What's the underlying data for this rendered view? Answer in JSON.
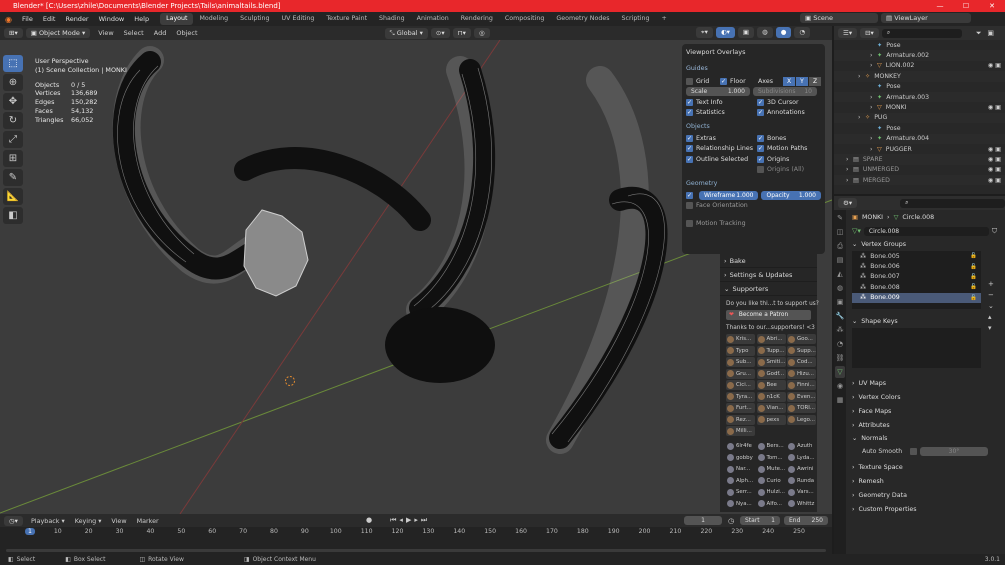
{
  "titlebar": {
    "title": "Blender* [C:\\Users\\zhile\\Documents\\Blender Projects\\Tails\\animaltails.blend]",
    "accent": "#e8272b"
  },
  "menu": {
    "items": [
      "File",
      "Edit",
      "Render",
      "Window",
      "Help"
    ],
    "workspaces": [
      "Layout",
      "Modeling",
      "Sculpting",
      "UV Editing",
      "Texture Paint",
      "Shading",
      "Animation",
      "Rendering",
      "Compositing",
      "Geometry Nodes",
      "Scripting"
    ],
    "active_workspace": "Layout",
    "scene": "Scene",
    "view_layer": "ViewLayer"
  },
  "viewport_header": {
    "mode": "Object Mode",
    "menus": [
      "View",
      "Select",
      "Add",
      "Object"
    ],
    "orientation": "Global"
  },
  "viewport_info": {
    "view_name": "User Perspective",
    "collection_line": "(1) Scene Collection | MONKI",
    "stats": [
      {
        "label": "Objects",
        "value": "0 / 5"
      },
      {
        "label": "Vertices",
        "value": "136,689"
      },
      {
        "label": "Edges",
        "value": "150,282"
      },
      {
        "label": "Faces",
        "value": "54,132"
      },
      {
        "label": "Triangles",
        "value": "66,052"
      }
    ]
  },
  "overlays": {
    "title": "Viewport Overlays",
    "guides_label": "Guides",
    "grid": "Grid",
    "floor": "Floor",
    "axes": "Axes",
    "axis_x": "X",
    "axis_y": "Y",
    "axis_z": "Z",
    "scale_label": "Scale",
    "scale_value": "1.000",
    "subdivisions_label": "Subdivisions",
    "subdivisions_value": "10",
    "text_info": "Text Info",
    "cursor_3d": "3D Cursor",
    "statistics": "Statistics",
    "annotations": "Annotations",
    "objects_label": "Objects",
    "extras": "Extras",
    "bones": "Bones",
    "relationship_lines": "Relationship Lines",
    "motion_paths": "Motion Paths",
    "outline_selected": "Outline Selected",
    "origins": "Origins",
    "origins_all": "Origins (All)",
    "geometry_label": "Geometry",
    "wireframe_label": "Wireframe",
    "wireframe_value": "1.000",
    "opacity_label": "Opacity",
    "opacity_value": "1.000",
    "face_orientation": "Face Orientation",
    "motion_tracking": "Motion Tracking"
  },
  "tail_panel": {
    "bake": "Bake",
    "settings": "Settings & Updates",
    "supporters": "Supporters",
    "question": "Do you like thi...t to support us?",
    "patron_button": "Become a Patron",
    "thanks": "Thanks to our...supporters! <3",
    "names_grid": [
      "Kris...",
      "Abri...",
      "Goo...",
      "Typo",
      "Tupp...",
      "Supp...",
      "Sub...",
      "Smiti...",
      "Cod...",
      "Gru...",
      "Godf...",
      "Hizu...",
      "Cici...",
      "Bee",
      "Finni...",
      "Tyra...",
      "n1cK",
      "Even...",
      "Furt...",
      "Vian...",
      "TORI...",
      "Rez...",
      "pexs",
      "Lego...",
      "Milli..."
    ],
    "names_list": [
      "6lr4fe",
      "Bers...",
      "Azuth",
      "gobby",
      "Tom...",
      "Lyda...",
      "Nar...",
      "Mute...",
      "Awrini",
      "Alph...",
      "Curio",
      "Runda",
      "Serr...",
      "Hulzi...",
      "Vars...",
      "Nya...",
      "Alfo...",
      "Whittz"
    ]
  },
  "timeline": {
    "menus": [
      "Playback",
      "Keying",
      "View",
      "Marker"
    ],
    "current_frame": "1",
    "start_label": "Start",
    "start_value": "1",
    "end_label": "End",
    "end_value": "250",
    "ruler": [
      "1",
      "10",
      "20",
      "30",
      "40",
      "50",
      "60",
      "70",
      "80",
      "90",
      "100",
      "110",
      "120",
      "130",
      "140",
      "150",
      "160",
      "170",
      "180",
      "190",
      "200",
      "210",
      "220",
      "230",
      "240",
      "250"
    ]
  },
  "statusbar": {
    "items": [
      "Select",
      "Box Select",
      "Rotate View",
      "Object Context Menu"
    ],
    "version": "3.0.1"
  },
  "outliner": {
    "rows": [
      {
        "label": "Pose",
        "indent": 3,
        "kind": "pose"
      },
      {
        "label": "Armature.002",
        "indent": 3,
        "kind": "armature"
      },
      {
        "label": "LION.002",
        "indent": 3,
        "kind": "mesh"
      },
      {
        "label": "MONKEY",
        "indent": 2,
        "kind": "armature-obj"
      },
      {
        "label": "Pose",
        "indent": 3,
        "kind": "pose"
      },
      {
        "label": "Armature.003",
        "indent": 3,
        "kind": "armature"
      },
      {
        "label": "MONKI",
        "indent": 3,
        "kind": "mesh"
      },
      {
        "label": "PUG",
        "indent": 2,
        "kind": "armature-obj"
      },
      {
        "label": "Pose",
        "indent": 3,
        "kind": "pose"
      },
      {
        "label": "Armature.004",
        "indent": 3,
        "kind": "armature"
      },
      {
        "label": "PUGGER",
        "indent": 3,
        "kind": "mesh"
      },
      {
        "label": "SPARE",
        "indent": 1,
        "kind": "collection"
      },
      {
        "label": "UNMERGED",
        "indent": 1,
        "kind": "collection"
      },
      {
        "label": "MERGED",
        "indent": 1,
        "kind": "collection"
      }
    ]
  },
  "properties": {
    "breadcrumb_object": "MONKI",
    "breadcrumb_mesh": "Circle.008",
    "mesh_name": "Circle.008",
    "vertex_groups_label": "Vertex Groups",
    "vertex_groups": [
      "Bone.005",
      "Bone.006",
      "Bone.007",
      "Bone.008",
      "Bone.009"
    ],
    "selected_group": "Bone.009",
    "shape_keys_label": "Shape Keys",
    "sections": [
      "UV Maps",
      "Vertex Colors",
      "Face Maps",
      "Attributes"
    ],
    "normals_label": "Normals",
    "auto_smooth_label": "Auto Smooth",
    "auto_smooth_value": "30°",
    "sections2": [
      "Texture Space",
      "Remesh",
      "Geometry Data",
      "Custom Properties"
    ]
  }
}
